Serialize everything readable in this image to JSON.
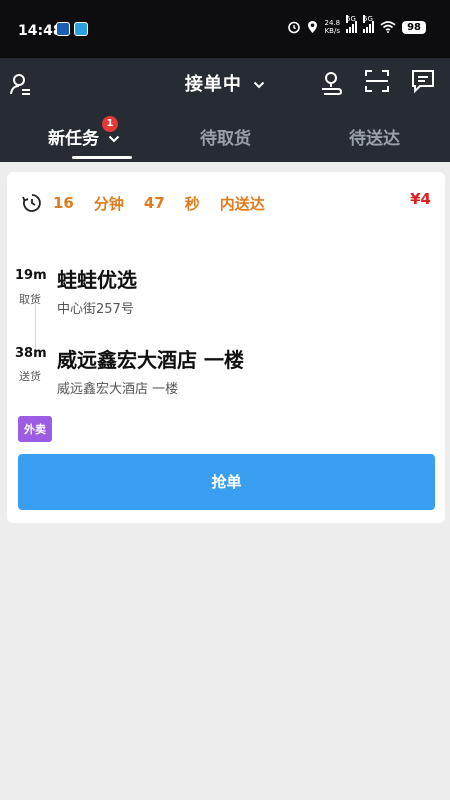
{
  "status_bar": {
    "time": "14:48",
    "net_speed": "24.8",
    "net_unit": "KB/s",
    "signal1": "5G",
    "signal2": "5G",
    "battery": "98"
  },
  "header": {
    "title": "接单中",
    "icons": {
      "left": "user-list-icon",
      "nav": "location-route-icon",
      "scan": "scan-icon",
      "message": "message-icon"
    }
  },
  "tabs": [
    {
      "label": "新任务",
      "badge": "1",
      "active": true
    },
    {
      "label": "待取货",
      "active": false
    },
    {
      "label": "待送达",
      "active": false
    }
  ],
  "order": {
    "deadline": {
      "minutes": "16",
      "min_unit": "分钟",
      "seconds": "47",
      "sec_unit": "秒",
      "suffix": "内送达"
    },
    "fee": "¥4",
    "pickup": {
      "distance": "19m",
      "type": "取货",
      "name": "蛙蛙优选",
      "address": "中心街257号"
    },
    "dropoff": {
      "distance": "38m",
      "type": "送货",
      "name": "威远鑫宏大酒店  一楼",
      "address": "威远鑫宏大酒店  一楼"
    },
    "tag": "外卖",
    "action": "抢单"
  },
  "colors": {
    "header_bg": "#272b33",
    "deadline": "#e07b1e",
    "fee": "#e02020",
    "tag": "#9c5ce4",
    "action": "#3a9ff0"
  }
}
